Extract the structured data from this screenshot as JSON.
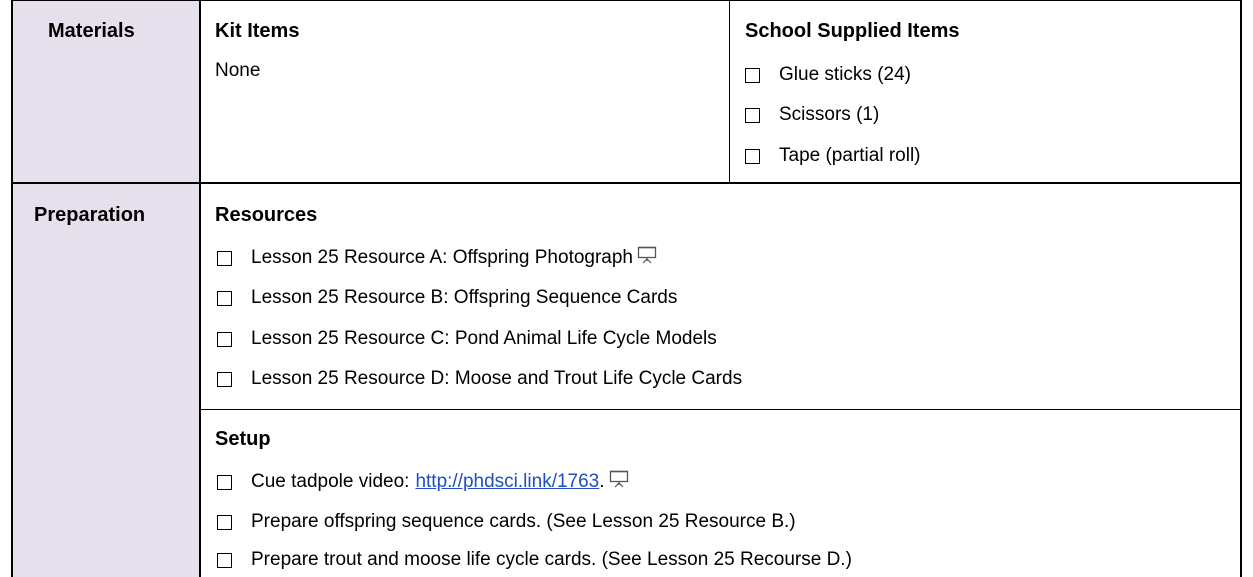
{
  "materials": {
    "label": "Materials",
    "kit_items": {
      "heading": "Kit Items",
      "value": "None"
    },
    "school_items": {
      "heading": "School Supplied Items",
      "items": [
        "Glue sticks (24)",
        "Scissors (1)",
        "Tape (partial roll)"
      ]
    }
  },
  "preparation": {
    "label": "Preparation",
    "resources": {
      "heading": "Resources",
      "items": [
        "Lesson 25 Resource A: Offspring Photograph",
        "Lesson 25 Resource B: Offspring Sequence Cards",
        "Lesson 25 Resource C: Pond Animal Life Cycle Models",
        "Lesson 25 Resource D: Moose and Trout Life Cycle Cards"
      ]
    },
    "setup": {
      "heading": "Setup",
      "item1_prefix": "Cue tadpole video:",
      "item1_link": "http://phdsci.link/1763",
      "item1_suffix": ".",
      "items": [
        "Prepare offspring sequence cards. (See Lesson 25 Resource B.)",
        "Prepare trout and moose life cycle cards. (See Lesson 25 Recourse D.)"
      ]
    }
  },
  "icons": {
    "projector": "projector-screen-icon",
    "checkbox": "checkbox-icon"
  }
}
